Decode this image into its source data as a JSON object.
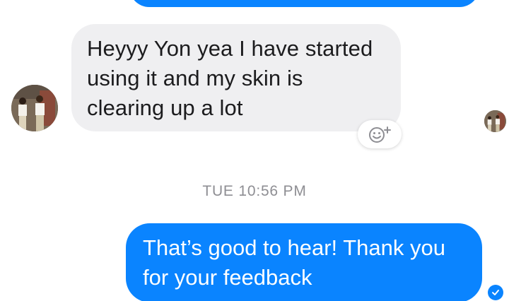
{
  "conversation": {
    "incoming": {
      "text_lines": [
        "Heyyy Yon yea I have started",
        "using it and my skin is",
        "clearing up a lot"
      ]
    },
    "timestamp": "TUE 10:56 PM",
    "outgoing": {
      "text_lines": [
        "That’s good to hear! Thank you",
        "for your feedback"
      ]
    }
  },
  "icons": {
    "reaction": "smiley-plus-icon",
    "seen": "check-circle-icon"
  },
  "colors": {
    "outgoing_bubble": "#0a84ff",
    "incoming_bubble": "#efeff1",
    "timestamp_text": "#8e8e93"
  }
}
